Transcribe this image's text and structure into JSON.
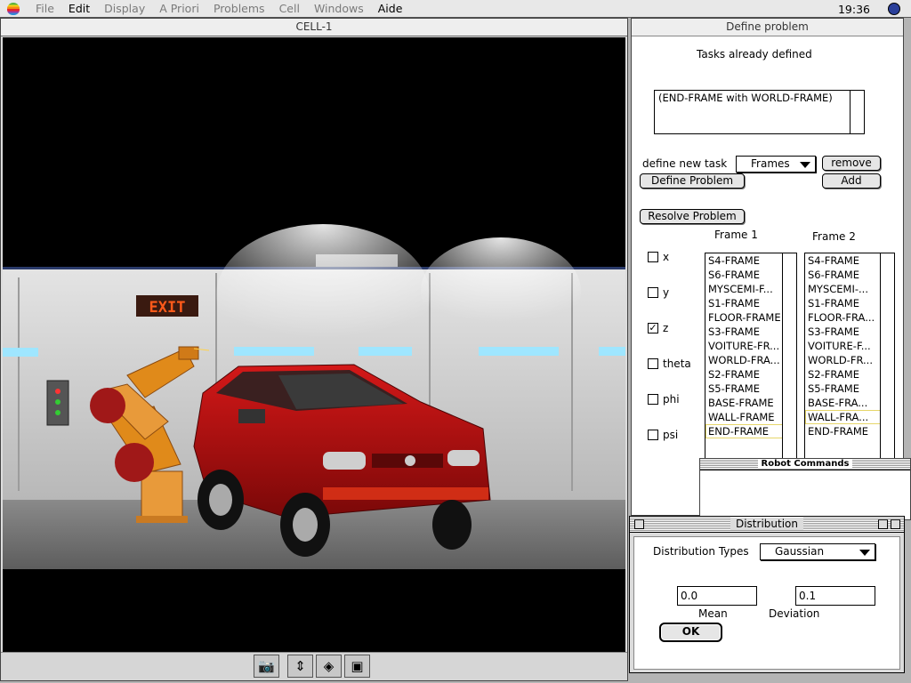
{
  "menubar": {
    "items": [
      {
        "label": "File",
        "enabled": false
      },
      {
        "label": "Edit",
        "enabled": true
      },
      {
        "label": "Display",
        "enabled": false
      },
      {
        "label": "A Priori",
        "enabled": false
      },
      {
        "label": "Problems",
        "enabled": false
      },
      {
        "label": "Cell",
        "enabled": false
      },
      {
        "label": "Windows",
        "enabled": false
      },
      {
        "label": "Aide",
        "enabled": true
      }
    ],
    "clock": "19:36"
  },
  "cell_window": {
    "title": "CELL-1",
    "scene_text": {
      "exit_sign": "EXIT"
    },
    "toolbar": [
      {
        "name": "camera-icon",
        "glyph": "📷"
      },
      {
        "name": "move-icon",
        "glyph": "⇕"
      },
      {
        "name": "rotate-icon",
        "glyph": "◈"
      },
      {
        "name": "cube-icon",
        "glyph": "▣"
      }
    ]
  },
  "define_problem": {
    "title": "Define problem",
    "tasks_heading": "Tasks already defined",
    "tasks": [
      "(END-FRAME with WORLD-FRAME)"
    ],
    "define_new_task_label": "define new task",
    "task_type": "Frames",
    "remove_label": "remove",
    "add_label": "Add",
    "define_problem_label": "Define Problem",
    "resolve_problem_label": "Resolve Problem",
    "frame1_heading": "Frame 1",
    "frame2_heading": "Frame 2",
    "frame1_items": [
      "S4-FRAME",
      "S6-FRAME",
      "MYSCEMI-F...",
      "S1-FRAME",
      "FLOOR-FRAME",
      "S3-FRAME",
      "VOITURE-FR...",
      "WORLD-FRA...",
      "S2-FRAME",
      "S5-FRAME",
      "BASE-FRAME",
      "WALL-FRAME",
      "END-FRAME"
    ],
    "frame2_items": [
      "S4-FRAME",
      "S6-FRAME",
      "MYSCEMI-...",
      "S1-FRAME",
      "FLOOR-FRA...",
      "S3-FRAME",
      "VOITURE-F...",
      "WORLD-FR...",
      "S2-FRAME",
      "S5-FRAME",
      "BASE-FRA...",
      "WALL-FRA...",
      "END-FRAME"
    ],
    "frame1_selected": "END-FRAME",
    "frame2_selected": "WALL-FRA...",
    "axes": [
      {
        "label": "x",
        "checked": false
      },
      {
        "label": "y",
        "checked": false
      },
      {
        "label": "z",
        "checked": true
      },
      {
        "label": "theta",
        "checked": false
      },
      {
        "label": "phi",
        "checked": false
      },
      {
        "label": "psi",
        "checked": false
      }
    ]
  },
  "robot_commands": {
    "title": "Robot Commands"
  },
  "distribution": {
    "title": "Distribution",
    "types_label": "Distribution Types",
    "type_value": "Gaussian",
    "mean_value": "0.0",
    "mean_label": "Mean",
    "deviation_value": "0.1",
    "deviation_label": "Deviation",
    "ok_label": "OK"
  },
  "colors": {
    "car": "#b01010",
    "robot": "#e08a1a",
    "wall": "#cfcfcf",
    "exit_sign": "#ff5a1a"
  }
}
